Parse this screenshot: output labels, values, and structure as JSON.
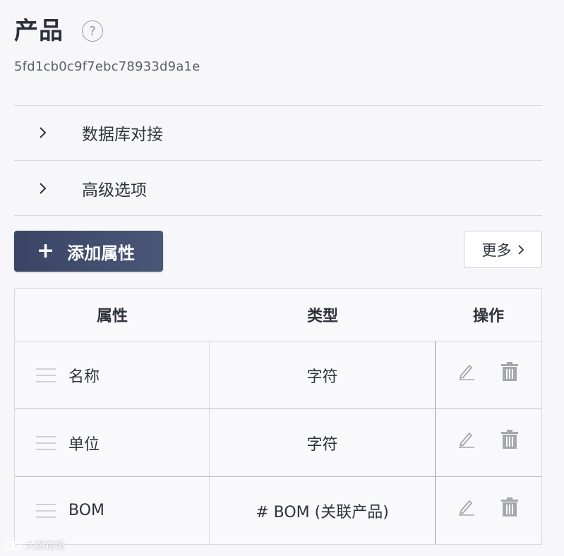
{
  "header": {
    "title": "产品",
    "help_icon": "question-circle-icon",
    "help_glyph": "?",
    "entity_id": "5fd1cb0c9f7ebc78933d9a1e"
  },
  "sections": [
    {
      "label": "数据库对接",
      "icon": "chevron-right-icon"
    },
    {
      "label": "高级选项",
      "icon": "chevron-right-icon"
    }
  ],
  "toolbar": {
    "add_attribute_label": "添加属性",
    "add_icon": "plus-icon",
    "add_glyph": "+",
    "more_label": "更多",
    "more_icon": "chevron-right-icon"
  },
  "table": {
    "columns": [
      "属性",
      "类型",
      "操作"
    ],
    "rows": [
      {
        "name": "名称",
        "type": "字符"
      },
      {
        "name": "单位",
        "type": "字符"
      },
      {
        "name": "BOM",
        "type": "# BOM (关联产品)"
      }
    ],
    "row_icons": [
      "drag-handle-icon",
      "edit-icon",
      "delete-icon"
    ]
  },
  "watermark": {
    "text": "大数跨境"
  },
  "colors": {
    "primary_button": "#3a4565",
    "border": "#d9d9dd",
    "background": "#f7f7f9",
    "icon_gray": "#a5a7ad"
  }
}
